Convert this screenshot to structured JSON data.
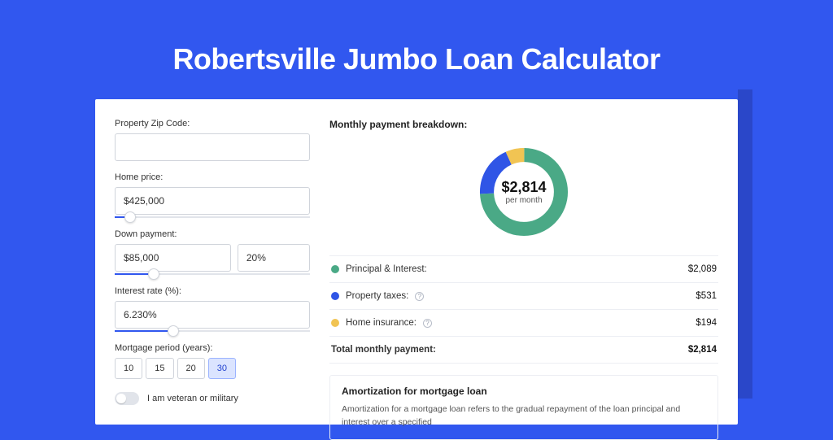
{
  "hero": {
    "title": "Robertsville Jumbo Loan Calculator"
  },
  "form": {
    "zip": {
      "label": "Property Zip Code:",
      "value": ""
    },
    "price": {
      "label": "Home price:",
      "value": "$425,000",
      "slider_pct": 8
    },
    "down": {
      "label": "Down payment:",
      "amount": "$85,000",
      "pct": "20%",
      "slider_pct": 20
    },
    "rate": {
      "label": "Interest rate (%):",
      "value": "6.230%",
      "slider_pct": 30
    },
    "period": {
      "label": "Mortgage period (years):",
      "options": [
        "10",
        "15",
        "20",
        "30"
      ],
      "active": "30"
    },
    "veteran": {
      "label": "I am veteran or military",
      "on": false
    }
  },
  "breakdown": {
    "title": "Monthly payment breakdown:",
    "center_amount": "$2,814",
    "center_sub": "per month",
    "rows": [
      {
        "label": "Principal & Interest:",
        "value": "$2,089",
        "color": "#4aa986",
        "info": false
      },
      {
        "label": "Property taxes:",
        "value": "$531",
        "color": "#2f55e6",
        "info": true
      },
      {
        "label": "Home insurance:",
        "value": "$194",
        "color": "#f1c453",
        "info": true
      }
    ],
    "total": {
      "label": "Total monthly payment:",
      "value": "$2,814"
    }
  },
  "amort": {
    "title": "Amortization for mortgage loan",
    "text": "Amortization for a mortgage loan refers to the gradual repayment of the loan principal and interest over a specified"
  },
  "chart_data": {
    "type": "pie",
    "title": "Monthly payment breakdown",
    "series": [
      {
        "name": "Principal & Interest",
        "value": 2089,
        "color": "#4aa986"
      },
      {
        "name": "Property taxes",
        "value": 531,
        "color": "#2f55e6"
      },
      {
        "name": "Home insurance",
        "value": 194,
        "color": "#f1c453"
      }
    ],
    "total": 2814,
    "center_label": "$2,814 per month"
  }
}
